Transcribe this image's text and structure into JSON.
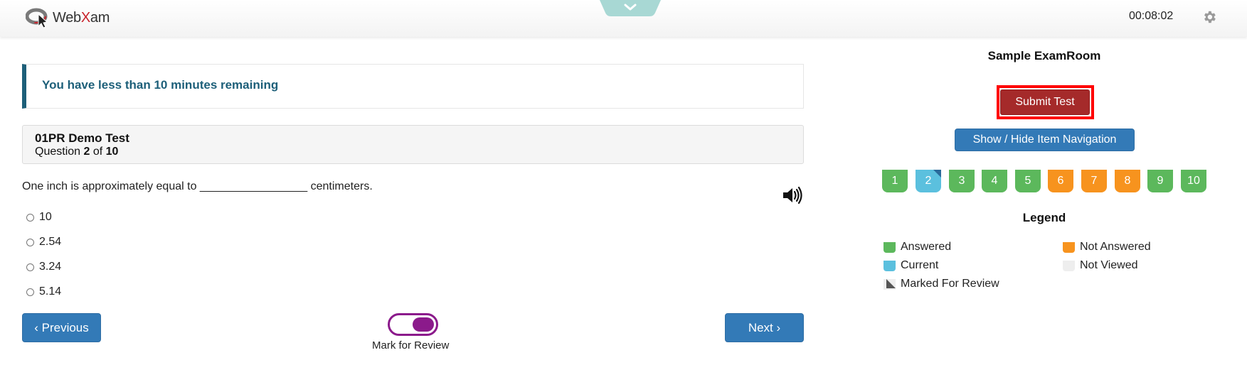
{
  "header": {
    "logo_web": "Web",
    "logo_x": "X",
    "logo_am": "am",
    "timer": "00:08:02"
  },
  "alert": {
    "text": "You have less than 10 minutes remaining"
  },
  "question_header": {
    "test_name": "01PR Demo Test",
    "question_prefix": "Question",
    "current": "2",
    "of_label": "of",
    "total": "10"
  },
  "question": {
    "text": "One inch is approximately equal to _________________ centimeters.",
    "options": [
      "10",
      "2.54",
      "3.24",
      "5.14"
    ]
  },
  "footer": {
    "previous_label": "‹ Previous",
    "next_label": "Next ›",
    "mark_for_review_label": "Mark for Review",
    "mark_for_review_on": true
  },
  "sidebar": {
    "room_name": "Sample ExamRoom",
    "submit_label": "Submit Test",
    "toggle_nav_label": "Show / Hide Item Navigation",
    "items": [
      {
        "label": "1",
        "status": "answered"
      },
      {
        "label": "2",
        "status": "current"
      },
      {
        "label": "3",
        "status": "answered"
      },
      {
        "label": "4",
        "status": "answered"
      },
      {
        "label": "5",
        "status": "answered"
      },
      {
        "label": "6",
        "status": "not-answered"
      },
      {
        "label": "7",
        "status": "not-answered"
      },
      {
        "label": "8",
        "status": "not-answered"
      },
      {
        "label": "9",
        "status": "answered"
      },
      {
        "label": "10",
        "status": "answered"
      }
    ],
    "legend": {
      "title": "Legend",
      "answered": "Answered",
      "not_answered": "Not Answered",
      "current": "Current",
      "not_viewed": "Not Viewed",
      "marked_for_review": "Marked For Review"
    }
  },
  "colors": {
    "answered": "#5cb85c",
    "not_answered": "#f7931e",
    "current": "#5bc0de",
    "not_viewed": "#eeeeee",
    "marked_fold": "#2a6a9a",
    "accent_blue": "#337ab7",
    "submit": "#a52a2a",
    "toggle": "#8b1a8b",
    "alert_text": "#1d5f79"
  }
}
